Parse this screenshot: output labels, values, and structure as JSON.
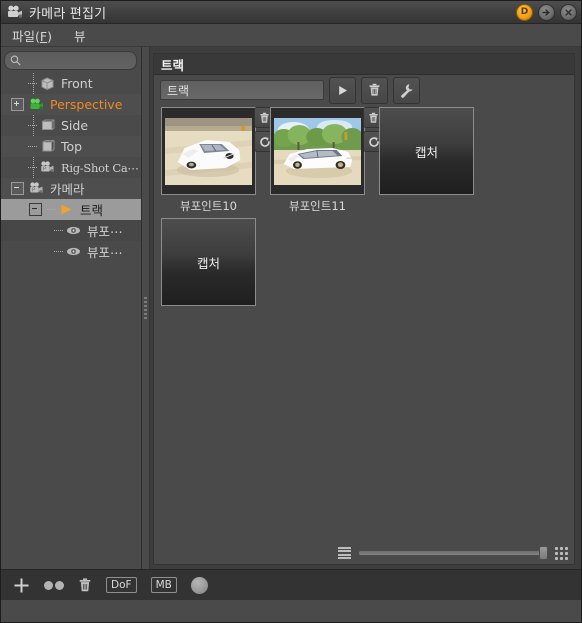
{
  "window": {
    "title": "카메라 편집기",
    "icon": "camera-icon",
    "buttons": [
      {
        "name": "dolby-button",
        "label": "D"
      },
      {
        "name": "detach-button",
        "label": "→"
      },
      {
        "name": "close-button",
        "label": "✕"
      }
    ]
  },
  "menubar": {
    "items": [
      {
        "name": "menu-file",
        "label": "파일(",
        "mnemonic": "F",
        "label_end": ")"
      },
      {
        "name": "menu-view",
        "label": "뷰"
      }
    ]
  },
  "sidebar": {
    "search": {
      "value": "",
      "placeholder": "",
      "icon": "search-icon"
    },
    "tree": [
      {
        "label": "Front",
        "icon": "cube-icon",
        "indent": 1,
        "expander": "none",
        "selected": false,
        "accent": false
      },
      {
        "label": "Perspective",
        "icon": "camera-green-icon",
        "indent": 0,
        "expander": "plus",
        "selected": false,
        "accent": true
      },
      {
        "label": "Side",
        "icon": "cube-icon",
        "indent": 1,
        "expander": "none",
        "selected": false,
        "accent": false
      },
      {
        "label": "Top",
        "icon": "cube-icon",
        "indent": 1,
        "expander": "none",
        "selected": false,
        "accent": false
      },
      {
        "label": "Rig-Shot Ca⋯",
        "icon": "camera-rig-icon",
        "indent": 1,
        "expander": "none",
        "selected": false,
        "accent": false,
        "serif": true
      },
      {
        "label": "카메라",
        "icon": "camera-rig-icon",
        "indent": 0,
        "expander": "minus",
        "selected": false,
        "accent": false
      },
      {
        "label": "트랙",
        "icon": "play-orange-icon",
        "indent": 1,
        "expander": "minus",
        "selected": true,
        "accent": false
      },
      {
        "label": "뷰포⋯",
        "icon": "eye-icon",
        "indent": 2,
        "expander": "none",
        "selected": false,
        "accent": false
      },
      {
        "label": "뷰포⋯",
        "icon": "eye-icon",
        "indent": 2,
        "expander": "none",
        "selected": false,
        "accent": false
      }
    ]
  },
  "panel": {
    "title": "트랙",
    "name_field": {
      "value": "트랙",
      "placeholder": ""
    },
    "tools": [
      {
        "name": "play-button",
        "icon": "play-icon"
      },
      {
        "name": "delete-button",
        "icon": "trash-icon"
      },
      {
        "name": "settings-button",
        "icon": "wrench-icon"
      }
    ],
    "thumbnails": [
      {
        "caption": "뷰포인트10",
        "type": "image",
        "image": "white-car-overhead",
        "buttons": [
          "trash-icon",
          "refresh-icon"
        ]
      },
      {
        "caption": "뷰포인트11",
        "type": "image",
        "image": "white-car-trees",
        "buttons": [
          "trash-icon",
          "refresh-icon"
        ]
      },
      {
        "caption": "",
        "type": "capture",
        "label": "캡처",
        "buttons": []
      },
      {
        "caption": "",
        "type": "capture",
        "label": "캡처",
        "buttons": []
      }
    ],
    "status": {
      "list_icon": "list-view-icon",
      "grid_icon": "grid-view-icon",
      "zoom_value": 100
    }
  },
  "bottom_toolbar": {
    "items": [
      {
        "name": "add-camera-button",
        "icon": "plus-icon",
        "label": ""
      },
      {
        "name": "duplicate-button",
        "icon": "two-dots-icon",
        "label": ""
      },
      {
        "name": "delete-camera-button",
        "icon": "trash-icon",
        "label": ""
      },
      {
        "name": "dof-button",
        "icon": "text-icon",
        "label": "DoF"
      },
      {
        "name": "motion-blur-button",
        "icon": "text-icon",
        "label": "MB"
      },
      {
        "name": "color-button",
        "icon": "circle-icon",
        "label": ""
      }
    ]
  },
  "colors": {
    "accent": "#ef8a22",
    "window_bg": "#4a4a4a",
    "panel_bg": "#3d3d3d",
    "selection": "#9b9b9b"
  }
}
